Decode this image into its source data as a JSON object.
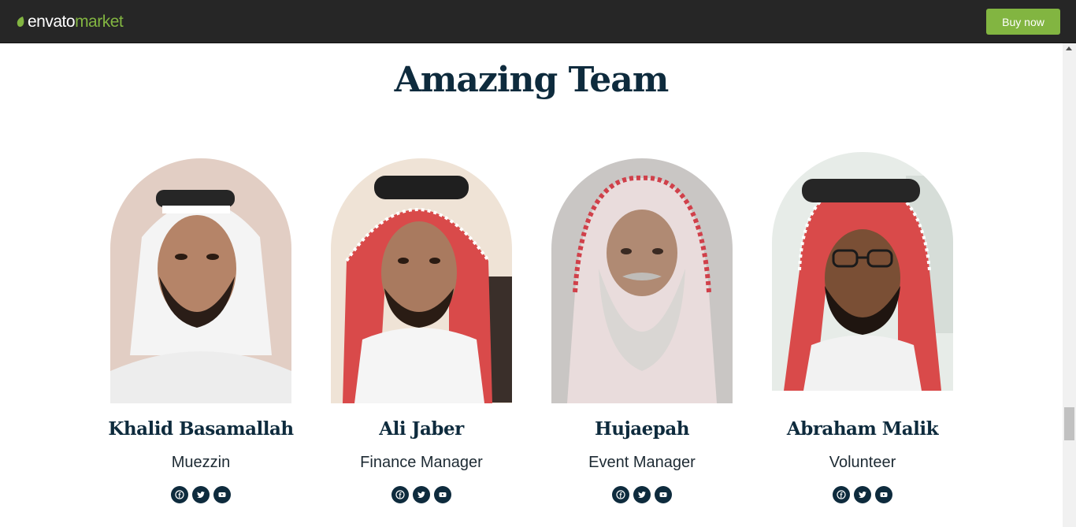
{
  "header": {
    "brand": "envato",
    "sub": "market",
    "buy_label": "Buy now"
  },
  "section": {
    "title": "Amazing Team"
  },
  "team": [
    {
      "name": "Khalid Basamallah",
      "role": "Muezzin"
    },
    {
      "name": "Ali Jaber",
      "role": "Finance Manager"
    },
    {
      "name": "Hujaepah",
      "role": "Event Manager"
    },
    {
      "name": "Abraham Malik",
      "role": "Volunteer"
    }
  ],
  "social_icons": [
    "facebook-icon",
    "twitter-icon",
    "youtube-icon"
  ],
  "colors": {
    "topbar": "#262626",
    "accent": "#82b541",
    "heading": "#0e2b3d",
    "text": "#1d2a33"
  }
}
